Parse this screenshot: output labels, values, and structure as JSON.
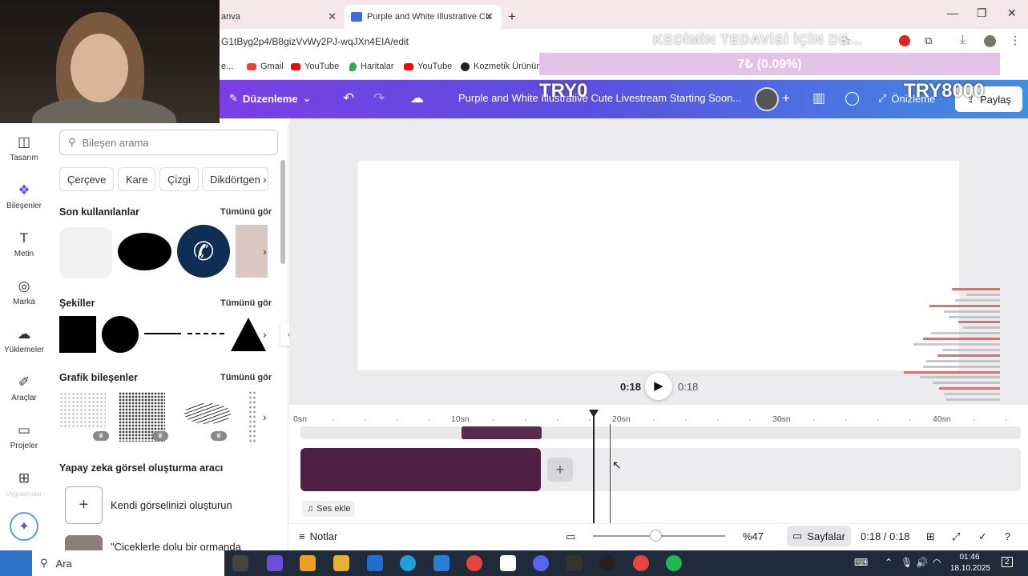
{
  "browser": {
    "tabs": [
      {
        "label": "anva",
        "active": false
      },
      {
        "label": "Purple and White Illustrative Cu",
        "active": true
      }
    ],
    "new_tab": "+",
    "url": "G1tByg2p4/B8gizVvWy2PJ-wqJXn4EIA/edit",
    "bookmarks": [
      {
        "label": "e...",
        "color": "#ffffff"
      },
      {
        "label": "Gmail",
        "color": "#ea4335"
      },
      {
        "label": "YouTube",
        "color": "#ff0000"
      },
      {
        "label": "Haritalar",
        "color": "#34a853"
      },
      {
        "label": "YouTube",
        "color": "#ff0000"
      },
      {
        "label": "Kozmetik Ürününd",
        "color": "#222222"
      }
    ]
  },
  "overlays": {
    "title": "KEDİMİN TEDAVİSİ İÇİN DE...",
    "donation": "7₺ (0.09%)",
    "try_left": "TRY0",
    "try_right": "TRY8000"
  },
  "canva": {
    "menu_label": "Düzenleme",
    "document_title": "Purple and White Illustrative Cute Livestream Starting Soon...",
    "preview_label": "Önizleme",
    "share_label": "Paylaş",
    "accent": "#7b3fe4"
  },
  "rail": [
    {
      "label": "Tasarım",
      "icon": "layout-icon"
    },
    {
      "label": "Bileşenler",
      "icon": "elements-icon",
      "active": true
    },
    {
      "label": "Metin",
      "icon": "text-icon"
    },
    {
      "label": "Marka",
      "icon": "brand-icon"
    },
    {
      "label": "Yüklemeler",
      "icon": "upload-icon"
    },
    {
      "label": "Araçlar",
      "icon": "tools-icon"
    },
    {
      "label": "Projeler",
      "icon": "folder-icon"
    },
    {
      "label": "Uygulamalar",
      "icon": "apps-icon"
    }
  ],
  "panel": {
    "search_placeholder": "Bileşen arama",
    "chips": [
      "Çerçeve",
      "Kare",
      "Çizgi",
      "Dikdörtgen"
    ],
    "sections": {
      "recent": {
        "title": "Son kullanılanlar",
        "link": "Tümünü gör"
      },
      "shapes": {
        "title": "Şekiller",
        "link": "Tümünü gör"
      },
      "graphics": {
        "title": "Grafik bileşenler",
        "link": "Tümünü gör"
      },
      "ai": {
        "title": "Yapay zeka görsel oluşturma aracı"
      }
    },
    "ai_create": "Kendi görselinizi oluşturun",
    "ai_prompt": "\"Çiçeklerle dolu bir ormanda"
  },
  "player": {
    "current_time": "0:18",
    "total_time": "0:18"
  },
  "timeline": {
    "ticks": [
      "0sn",
      "10sn",
      "20sn",
      "30sn",
      "40sn"
    ],
    "audio_add": "Ses ekle"
  },
  "footer": {
    "notes": "Notlar",
    "zoom": "%47",
    "zoom_fraction": 0.47,
    "pages": "Sayfalar",
    "time": "0:18 / 0:18"
  },
  "taskbar": {
    "search": "Ara",
    "time": "01:46",
    "date": "18.10.2025",
    "notifications": "2"
  }
}
